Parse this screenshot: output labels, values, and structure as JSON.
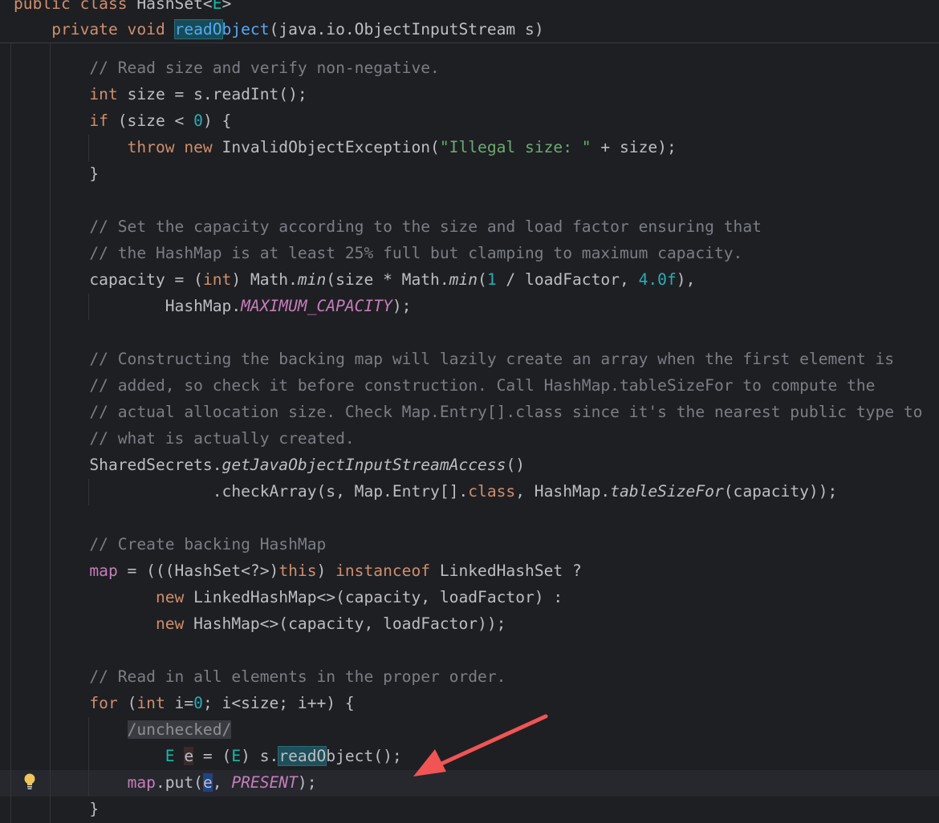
{
  "sticky": [
    [
      [
        "kw",
        "public class "
      ],
      [
        "",
        "HashSet<"
      ],
      [
        "tp",
        "E"
      ],
      [
        "",
        ">"
      ]
    ],
    [
      [
        "",
        "    "
      ],
      [
        "kw",
        "private void "
      ],
      [
        "decl hl",
        "readO"
      ],
      [
        "decl",
        "bject"
      ],
      [
        "",
        "(java.io.ObjectInputStream s)"
      ]
    ]
  ],
  "lines": [
    [
      [
        "",
        "        "
      ],
      [
        "cm",
        "// Read size and verify non-negative."
      ]
    ],
    [
      [
        "",
        "        "
      ],
      [
        "kw",
        "int "
      ],
      [
        "",
        "size = s.readInt();"
      ]
    ],
    [
      [
        "",
        "        "
      ],
      [
        "kw",
        "if "
      ],
      [
        "",
        "(size < "
      ],
      [
        "num",
        "0"
      ],
      [
        "",
        ") {"
      ]
    ],
    [
      [
        "",
        "            "
      ],
      [
        "kw",
        "throw new "
      ],
      [
        "",
        "InvalidObjectException("
      ],
      [
        "str",
        "\"Illegal size: \""
      ],
      [
        "",
        " + size);"
      ]
    ],
    [
      [
        "",
        "        }"
      ]
    ],
    [],
    [
      [
        "",
        "        "
      ],
      [
        "cm",
        "// Set the capacity according to the size and load factor ensuring that"
      ]
    ],
    [
      [
        "",
        "        "
      ],
      [
        "cm",
        "// the HashMap is at least 25% full but clamping to maximum capacity."
      ]
    ],
    [
      [
        "",
        "        capacity = ("
      ],
      [
        "kw",
        "int"
      ],
      [
        "",
        ") Math."
      ],
      [
        "it",
        "min"
      ],
      [
        "",
        "(size * Math."
      ],
      [
        "it",
        "min"
      ],
      [
        "",
        "("
      ],
      [
        "num",
        "1"
      ],
      [
        "",
        " / loadFactor, "
      ],
      [
        "num",
        "4.0f"
      ],
      [
        "",
        "),"
      ]
    ],
    [
      [
        "",
        "                HashMap."
      ],
      [
        "sf",
        "MAXIMUM_CAPACITY"
      ],
      [
        "",
        ");"
      ]
    ],
    [],
    [
      [
        "",
        "        "
      ],
      [
        "cm",
        "// Constructing the backing map will lazily create an array when the first element is"
      ]
    ],
    [
      [
        "",
        "        "
      ],
      [
        "cm",
        "// added, so check it before construction. Call HashMap.tableSizeFor to compute the"
      ]
    ],
    [
      [
        "",
        "        "
      ],
      [
        "cm",
        "// actual allocation size. Check Map.Entry[].class since it's the nearest public type to"
      ]
    ],
    [
      [
        "",
        "        "
      ],
      [
        "cm",
        "// what is actually created."
      ]
    ],
    [
      [
        "",
        "        SharedSecrets."
      ],
      [
        "it",
        "getJavaObjectInputStreamAccess"
      ],
      [
        "",
        "()"
      ]
    ],
    [
      [
        "",
        "                     .checkArray(s, Map.Entry[]."
      ],
      [
        "kw",
        "class"
      ],
      [
        "",
        ", HashMap."
      ],
      [
        "it",
        "tableSizeFor"
      ],
      [
        "",
        "(capacity));"
      ]
    ],
    [],
    [
      [
        "",
        "        "
      ],
      [
        "cm",
        "// Create backing HashMap"
      ]
    ],
    [
      [
        "",
        "        "
      ],
      [
        "fld",
        "map"
      ],
      [
        "",
        " = (((HashSet<?>)"
      ],
      [
        "kw",
        "this"
      ],
      [
        "",
        ") "
      ],
      [
        "kw",
        "instanceof "
      ],
      [
        "",
        "LinkedHashSet ?"
      ]
    ],
    [
      [
        "",
        "               "
      ],
      [
        "kw",
        "new "
      ],
      [
        "",
        "LinkedHashMap<>(capacity, loadFactor) :"
      ]
    ],
    [
      [
        "",
        "               "
      ],
      [
        "kw",
        "new "
      ],
      [
        "",
        "HashMap<>(capacity, loadFactor));"
      ]
    ],
    [],
    [
      [
        "",
        "        "
      ],
      [
        "cm",
        "// Read in all elements in the proper order."
      ]
    ],
    [
      [
        "",
        "        "
      ],
      [
        "kw",
        "for "
      ],
      [
        "",
        "("
      ],
      [
        "kw",
        "int "
      ],
      [
        "",
        "i="
      ],
      [
        "num",
        "0"
      ],
      [
        "",
        "; i<size; i++) {"
      ]
    ],
    [
      [
        "",
        "            "
      ],
      [
        "sup",
        "/unchecked/"
      ]
    ],
    [
      [
        "",
        "                "
      ],
      [
        "tp",
        "E "
      ],
      [
        "ev",
        "e"
      ],
      [
        "",
        " = ("
      ],
      [
        "tp",
        "E"
      ],
      [
        "",
        ") s."
      ],
      [
        "hl2",
        "readO"
      ],
      [
        "",
        "bject();"
      ]
    ],
    [
      [
        "",
        "            "
      ],
      [
        "fld",
        "map"
      ],
      [
        "",
        ".put("
      ],
      [
        "cur",
        "e"
      ],
      [
        "",
        ", "
      ],
      [
        "sf",
        "PRESENT"
      ],
      [
        "",
        ");"
      ]
    ],
    [
      [
        "",
        "        }"
      ]
    ]
  ],
  "colors": {
    "background": "#1E1F22",
    "keyword": "#CF8E6D",
    "comment": "#7A7E85",
    "number": "#2AACB8",
    "string": "#6AAB73",
    "annotation_arrow": "#F05454"
  },
  "icons": {
    "gutter": "lightbulb-icon",
    "annotation": "red-arrow"
  }
}
